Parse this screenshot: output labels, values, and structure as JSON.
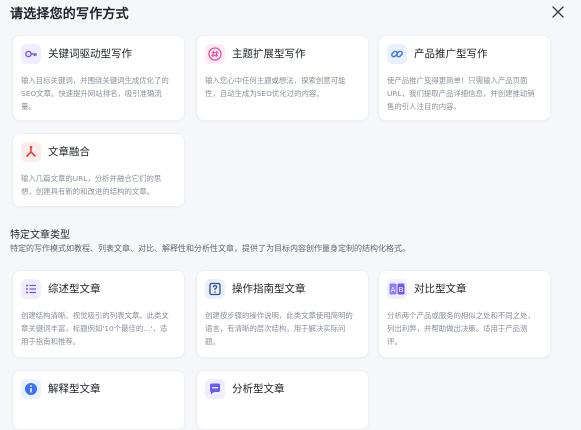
{
  "dialog": {
    "title": "请选择您的写作方式"
  },
  "cards": [
    {
      "title": "关键词驱动型写作",
      "desc": "输入目标关键词，并围绕关键词生成优化了的SEO文章。快速提升网站排名，吸引准确流量。"
    },
    {
      "title": "主题扩展型写作",
      "desc": "输入您心中任何主题或想法，探索创意可能性，自动生成为SEO优化过的内容。"
    },
    {
      "title": "产品推广型写作",
      "desc": "使产品推广变得更简单！只需输入产品页面URL，我们提取产品详细信息，并创建推动销售的引人注目的内容。"
    },
    {
      "title": "文章融合",
      "desc": "输入几篇文章的URL，分析并融合它们的思想，创建具有新的和改进的结构的文章。"
    }
  ],
  "section": {
    "title": "特定文章类型",
    "desc": "特定的写作模式如教程、列表文章、对比、解释性和分析性文章，提供了为目标内容创作量身定制的结构化格式。"
  },
  "type_cards": [
    {
      "title": "综述型文章",
      "desc": "创建结构清晰、视觉吸引的列表文章。此类文章关键词丰富，标题例如'10个最佳的...'，适用于指南和推荐。"
    },
    {
      "title": "操作指南型文章",
      "desc": "创建按步骤的操作说明，此类文章使用简明的语言，有清晰的层次结构，用于解决实际问题。"
    },
    {
      "title": "对比型文章",
      "desc": "分析两个产品或服务的相似之处和不同之处，列出利弊，并帮助做出决策。适用于产品测评。"
    },
    {
      "title": "解释型文章",
      "desc": ""
    },
    {
      "title": "分析型文章",
      "desc": ""
    }
  ],
  "colors": {
    "purple": "#6b5bf5",
    "pink": "#e2539d",
    "blue": "#3a72f0",
    "red": "#e0463f"
  },
  "icons": {
    "close": "close-icon",
    "keyword": "key-icon",
    "topic": "hashtag-icon",
    "product": "link-icon",
    "merge": "merge-icon",
    "list": "list-icon",
    "guide": "question-book-icon",
    "compare": "ab-compare-icon",
    "explain": "info-icon",
    "analysis": "chat-analysis-icon"
  }
}
